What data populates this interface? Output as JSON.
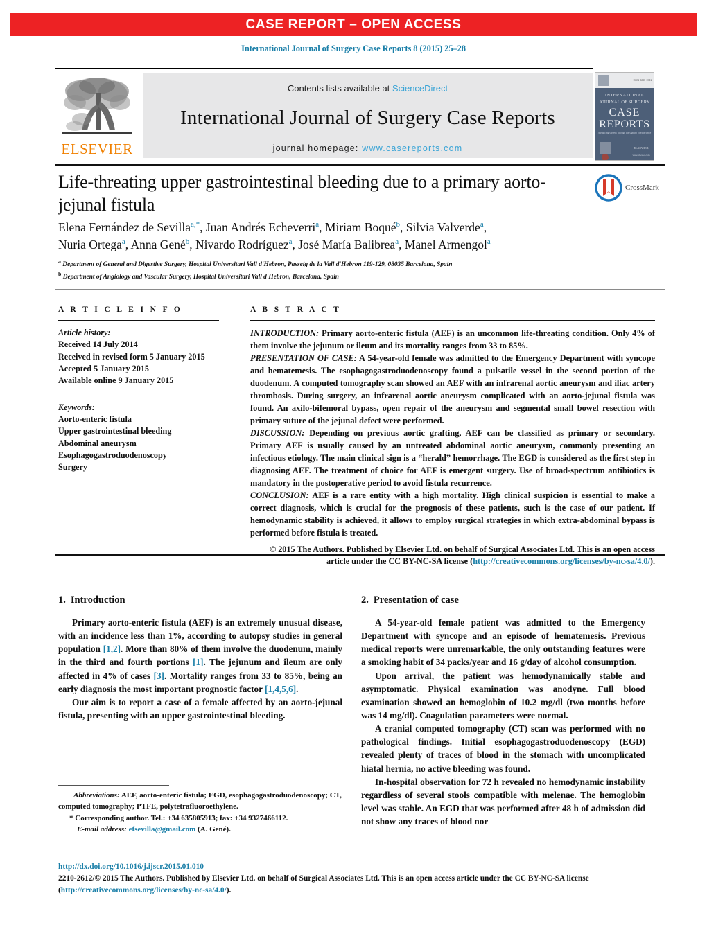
{
  "banner": {
    "text": "CASE REPORT – OPEN ACCESS",
    "color": "#ed2224"
  },
  "running_head": "International Journal of Surgery Case Reports 8 (2015) 25–28",
  "masthead": {
    "publisher": "ELSEVIER",
    "publisher_color": "#f08000",
    "contents_prefix": "Contents lists available at ",
    "contents_link": "ScienceDirect",
    "journal_title": "International Journal of Surgery Case Reports",
    "homepage_prefix": "journal homepage: ",
    "homepage_url": "www.casereports.com",
    "link_color": "#3aa4d6",
    "cover": {
      "line1": "INTERNATIONAL",
      "line2": "JOURNAL OF SURGERY",
      "line3": "CASE",
      "line4": "REPORTS",
      "tagline": "Advancing surgery through the sharing of experience",
      "footer_url": "www.elsevier.com",
      "bg_color": "#4d5f78"
    }
  },
  "article": {
    "title": "Life-threating upper gastrointestinal bleeding due to a primary aorto-jejunal fistula",
    "crossmark_label": "CrossMark",
    "authors_line1": "Elena Fernández de Sevilla",
    "authors": [
      {
        "name": "Elena Fernández de Sevilla",
        "marks": "a,*"
      },
      {
        "name": "Juan Andrés Echeverri",
        "marks": "a"
      },
      {
        "name": "Miriam Boqué",
        "marks": "b"
      },
      {
        "name": "Silvia Valverde",
        "marks": "a"
      },
      {
        "name": "Nuria Ortega",
        "marks": "a"
      },
      {
        "name": "Anna Gené",
        "marks": "b"
      },
      {
        "name": "Nivardo Rodríguez",
        "marks": "a"
      },
      {
        "name": "José María Balibrea",
        "marks": "a"
      },
      {
        "name": "Manel Armengol",
        "marks": "a"
      }
    ],
    "affiliations": [
      {
        "mark": "a",
        "text": "Department of General and Digestive Surgery, Hospital Universitari Vall d'Hebron, Passeig de la Vall d'Hebron 119-129, 08035 Barcelona, Spain"
      },
      {
        "mark": "b",
        "text": "Department of Angiology and Vascular Surgery, Hospital Universitari Vall d'Hebron, Barcelona, Spain"
      }
    ]
  },
  "article_info": {
    "heading": "A R T I C L E   I N F O",
    "history_heading": "Article history:",
    "history": [
      "Received 14 July 2014",
      "Received in revised form 5 January 2015",
      "Accepted 5 January 2015",
      "Available online 9 January 2015"
    ],
    "keywords_heading": "Keywords:",
    "keywords": [
      "Aorto-enteric fistula",
      "Upper gastrointestinal bleeding",
      "Abdominal aneurysm",
      "Esophagogastroduodenoscopy",
      "Surgery"
    ]
  },
  "abstract": {
    "heading": "A B S T R A C T",
    "sections": [
      {
        "label": "INTRODUCTION:",
        "text": " Primary aorto-enteric fistula (AEF) is an uncommon life-threating condition. Only 4% of them involve the jejunum or ileum and its mortality ranges from 33 to 85%."
      },
      {
        "label": "PRESENTATION OF CASE:",
        "text": " A 54-year-old female was admitted to the Emergency Department with syncope and hematemesis. The esophagogastroduodenoscopy found a pulsatile vessel in the second portion of the duodenum. A computed tomography scan showed an AEF with an infrarenal aortic aneurysm and iliac artery thrombosis. During surgery, an infrarenal aortic aneurysm complicated with an aorto-jejunal fistula was found. An axilo-bifemoral bypass, open repair of the aneurysm and segmental small bowel resection with primary suture of the jejunal defect were performed."
      },
      {
        "label": "DISCUSSION:",
        "text": " Depending on previous aortic grafting, AEF can be classified as primary or secondary. Primary AEF is usually caused by an untreated abdominal aortic aneurysm, commonly presenting an infectious etiology. The main clinical sign is a “herald” hemorrhage. The EGD is considered as the first step in diagnosing AEF. The treatment of choice for AEF is emergent surgery. Use of broad-spectrum antibiotics is mandatory in the postoperative period to avoid fistula recurrence."
      },
      {
        "label": "CONCLUSION:",
        "text": " AEF is a rare entity with a high mortality. High clinical suspicion is essential to make a correct diagnosis, which is crucial for the prognosis of these patients, such is the case of our patient. If hemodynamic stability is achieved, it allows to employ surgical strategies in which extra-abdominal bypass is performed before fistula is treated."
      }
    ],
    "copyright_text": "© 2015 The Authors. Published by Elsevier Ltd. on behalf of Surgical Associates Ltd. This is an open access article under the CC BY-NC-SA license (",
    "copyright_link": "http://creativecommons.org/licenses/by-nc-sa/4.0/",
    "copyright_tail": ")."
  },
  "body": {
    "left_column": {
      "section_number": "1.",
      "section_title": "Introduction",
      "paragraph_1_a": "Primary aorto-enteric fistula (AEF) is an extremely unusual disease, with an incidence less than 1%, according to autopsy studies in general population ",
      "ref_1": "[1,2]",
      "paragraph_1_b": ". More than 80% of them involve the duodenum, mainly in the third and fourth portions ",
      "ref_2": "[1]",
      "paragraph_1_c": ". The jejunum and ileum are only affected in 4% of cases ",
      "ref_3": "[3]",
      "paragraph_1_d": ". Mortality ranges from 33 to 85%, being an early diagnosis the most important prognostic factor ",
      "ref_4": "[1,4,5,6]",
      "paragraph_1_e": ".",
      "paragraph_2": "Our aim is to report a case of a female affected by an aorto-jejunal fistula, presenting with an upper gastrointestinal bleeding."
    },
    "right_column": {
      "section_number": "2.",
      "section_title": "Presentation of case",
      "paragraph_1": "A 54-year-old female patient was admitted to the Emergency Department with syncope and an episode of hematemesis. Previous medical reports were unremarkable, the only outstanding features were a smoking habit of 34 packs/year and 16 g/day of alcohol consumption.",
      "paragraph_2": "Upon arrival, the patient was hemodynamically stable and asymptomatic. Physical examination was anodyne. Full blood examination showed an hemoglobin of 10.2 mg/dl (two months before was 14 mg/dl). Coagulation parameters were normal.",
      "paragraph_3": "A cranial computed tomography (CT) scan was performed with no pathological findings. Initial esophagogastroduodenoscopy (EGD) revealed plenty of traces of blood in the stomach with uncomplicated hiatal hernia, no active bleeding was found.",
      "paragraph_4": "In-hospital observation for 72 h revealed no hemodynamic instability regardless of several stools compatible with melenae. The hemoglobin level was stable. An EGD that was performed after 48 h of admission did not show any traces of blood nor"
    }
  },
  "footnotes": {
    "abbrev_label": "Abbreviations:",
    "abbrev_text": " AEF, aorto-enteric fistula; EGD, esophagogastroduodenoscopy; CT, computed tomography; PTFE, polytetrafluoroethylene.",
    "star": "*",
    "corresponding_text": " Corresponding author. Tel.: +34 635805913; fax: +34 9327466112.",
    "email_label": "E-mail address:",
    "email": "efsevilla@gmail.com",
    "email_attribution": " (A. Gené)."
  },
  "footer": {
    "doi": "http://dx.doi.org/10.1016/j.ijscr.2015.01.010",
    "issn_line": "2210-2612/© 2015 The Authors. Published by Elsevier Ltd. on behalf of Surgical Associates Ltd. This is an open access article under the CC BY-NC-SA license",
    "cc_open": "(",
    "cc_link": "http://creativecommons.org/licenses/by-nc-sa/4.0/",
    "cc_close": ")."
  },
  "colors": {
    "accent_red": "#ed2224",
    "link_blue": "#1a7fa8",
    "sd_blue": "#3aa4d6",
    "elsevier_orange": "#f08000"
  }
}
